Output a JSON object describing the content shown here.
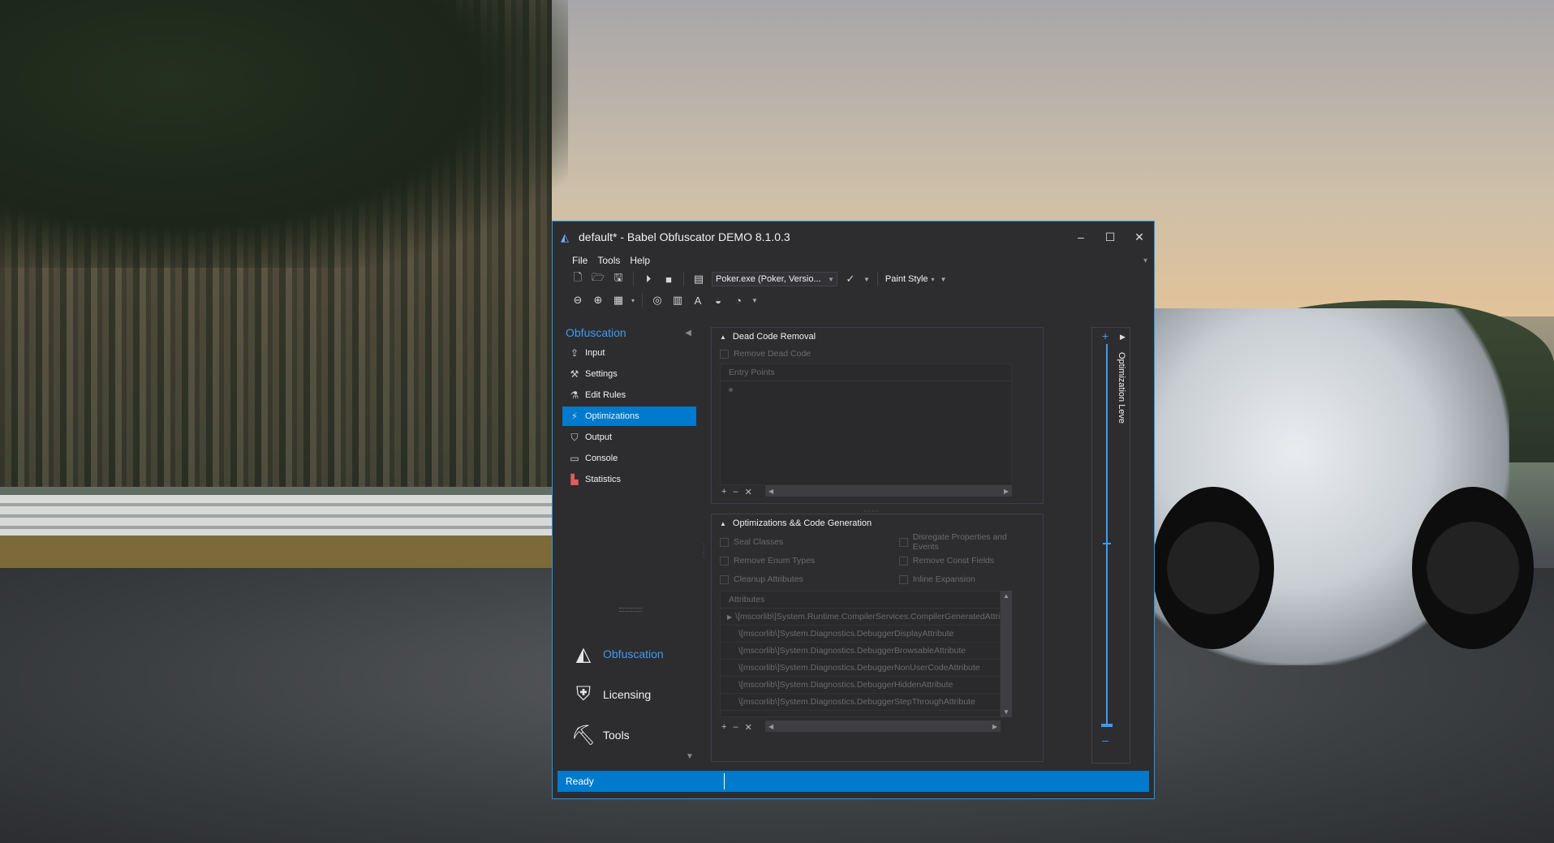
{
  "window": {
    "title": "default* -  Babel Obfuscator DEMO 8.1.0.3",
    "controls": {
      "minimize": "–",
      "maximize": "☐",
      "close": "✕"
    }
  },
  "menu": [
    "File",
    "Tools",
    "Help"
  ],
  "toolbar": {
    "assembly_combo": "Poker.exe (Poker, Versio...",
    "paint_style": "Paint Style"
  },
  "nav": {
    "title": "Obfuscation",
    "items": [
      {
        "label": "Input",
        "icon": "input-icon"
      },
      {
        "label": "Settings",
        "icon": "settings-icon"
      },
      {
        "label": "Edit Rules",
        "icon": "edit-rules-icon"
      },
      {
        "label": "Optimizations",
        "icon": "optimizations-icon",
        "active": true
      },
      {
        "label": "Output",
        "icon": "output-icon"
      },
      {
        "label": "Console",
        "icon": "console-icon"
      },
      {
        "label": "Statistics",
        "icon": "statistics-icon"
      }
    ],
    "sections": [
      {
        "label": "Obfuscation",
        "selected": true
      },
      {
        "label": "Licensing"
      },
      {
        "label": "Tools"
      }
    ]
  },
  "dead_code": {
    "header": "Dead Code Removal",
    "remove_dead_code": "Remove Dead Code",
    "entry_points": "Entry Points"
  },
  "optim": {
    "header": "Optimizations && Code Generation",
    "checks_left": [
      "Seal Classes",
      "Remove Enum Types",
      "Cleanup Attributes"
    ],
    "checks_right": [
      "Disregate Properties and Events",
      "Remove Const Fields",
      "Inline Expansion"
    ],
    "attributes_header": "Attributes",
    "attributes": [
      "\\[mscorlib\\]System.Runtime.CompilerServices.CompilerGeneratedAttribute",
      "\\[mscorlib\\]System.Diagnostics.DebuggerDisplayAttribute",
      "\\[mscorlib\\]System.Diagnostics.DebuggerBrowsableAttribute",
      "\\[mscorlib\\]System.Diagnostics.DebuggerNonUserCodeAttribute",
      "\\[mscorlib\\]System.Diagnostics.DebuggerHiddenAttribute",
      "\\[mscorlib\\]System.Diagnostics.DebuggerStepThroughAttribute"
    ]
  },
  "grid_buttons": {
    "add": "+",
    "remove": "–",
    "clear": "✕"
  },
  "level": {
    "label": "Optimization Leve",
    "plus": "+",
    "minus": "–"
  },
  "status": {
    "text": "Ready"
  },
  "colors": {
    "accent": "#007acc",
    "link": "#3d9bf0",
    "window_bg": "#2d2d30"
  }
}
